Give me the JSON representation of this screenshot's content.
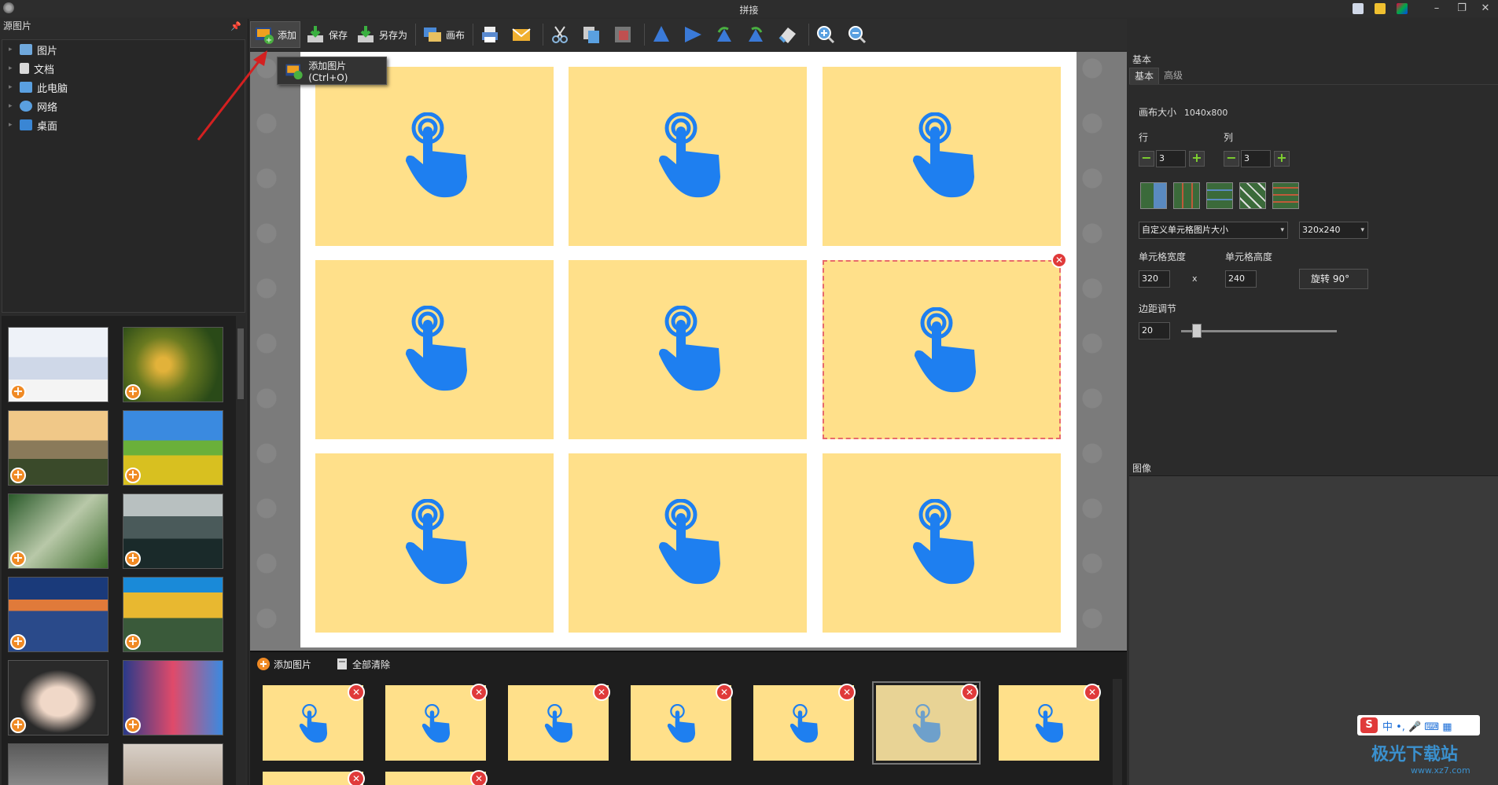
{
  "window": {
    "title": "拼接"
  },
  "left": {
    "source_header": "源图片",
    "tree": [
      {
        "label": "图片",
        "icon": "pictures-folder-icon",
        "color": "#6fa8dc"
      },
      {
        "label": "文档",
        "icon": "documents-folder-icon",
        "color": "#d9d9d9"
      },
      {
        "label": "此电脑",
        "icon": "computer-icon",
        "color": "#5aa0e0"
      },
      {
        "label": "网络",
        "icon": "network-icon",
        "color": "#5aa0e0"
      },
      {
        "label": "桌面",
        "icon": "desktop-folder-icon",
        "color": "#3a86d4"
      }
    ]
  },
  "toolbar": {
    "add": "添加",
    "save": "保存",
    "save_as": "另存为",
    "canvas": "画布"
  },
  "tooltip": {
    "text": "添加图片 (Ctrl+O)"
  },
  "strip": {
    "add_image": "添加图片",
    "clear_all": "全部清除"
  },
  "right": {
    "basic_header": "基本",
    "tabs": [
      "基本",
      "高级"
    ],
    "canvas_size_label": "画布大小",
    "canvas_size_value": "1040x800",
    "rows_label": "行",
    "rows_value": "3",
    "cols_label": "列",
    "cols_value": "3",
    "cell_size_mode": "自定义单元格图片大小",
    "cell_size_preset": "320x240",
    "cell_width_label": "单元格宽度",
    "cell_height_label": "单元格高度",
    "cell_width": "320",
    "times_sign": "x",
    "cell_height": "240",
    "rotate_button": "旋转 90°",
    "margin_label": "边距调节",
    "margin_value": "20",
    "image_header": "图像"
  },
  "ime": {
    "label": "中 •, 🎤 ⌨ ▦"
  },
  "watermark": {
    "text": "极光下载站",
    "url": "www.xz7.com"
  },
  "colors": {
    "cell_bg": "#ffe08a",
    "hand_blue": "#1e7ff0",
    "close_red": "#e03a3a",
    "add_orange": "#f08a24"
  }
}
